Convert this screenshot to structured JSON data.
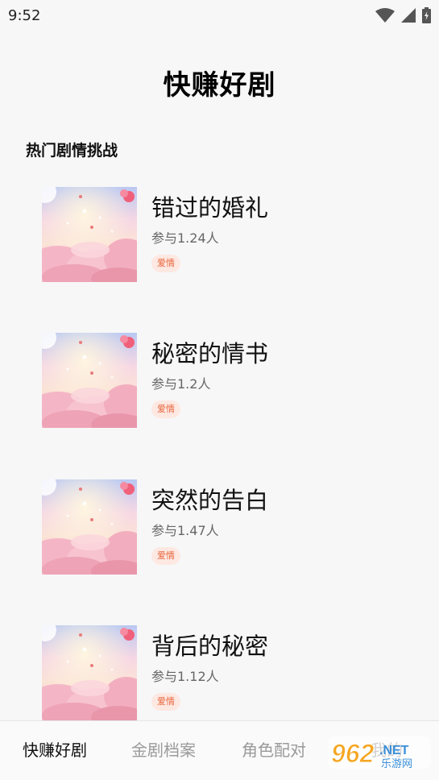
{
  "status_bar": {
    "time": "9:52"
  },
  "app": {
    "title": "快赚好剧"
  },
  "section": {
    "title": "热门剧情挑战"
  },
  "dramas": [
    {
      "name": "错过的婚礼",
      "participants": "参与1.24人",
      "tag": "爱情"
    },
    {
      "name": "秘密的情书",
      "participants": "参与1.2人",
      "tag": "爱情"
    },
    {
      "name": "突然的告白",
      "participants": "参与1.47人",
      "tag": "爱情"
    },
    {
      "name": "背后的秘密",
      "participants": "参与1.12人",
      "tag": "爱情"
    }
  ],
  "bottom_nav": {
    "items": [
      {
        "label": "快赚好剧",
        "active": true
      },
      {
        "label": "金剧档案",
        "active": false
      },
      {
        "label": "角色配对",
        "active": false
      },
      {
        "label": "我的",
        "active": false
      }
    ]
  },
  "watermark": {
    "brand": "962",
    "suffix": ".NET",
    "subtitle": "乐游网"
  },
  "colors": {
    "tag_text": "#e8663c",
    "tag_bg": "#fde8e2",
    "active_nav": "#111111",
    "inactive_nav": "#9a9a9a"
  },
  "icons": [
    "wifi-icon",
    "cell-signal-icon",
    "battery-charging-icon"
  ]
}
